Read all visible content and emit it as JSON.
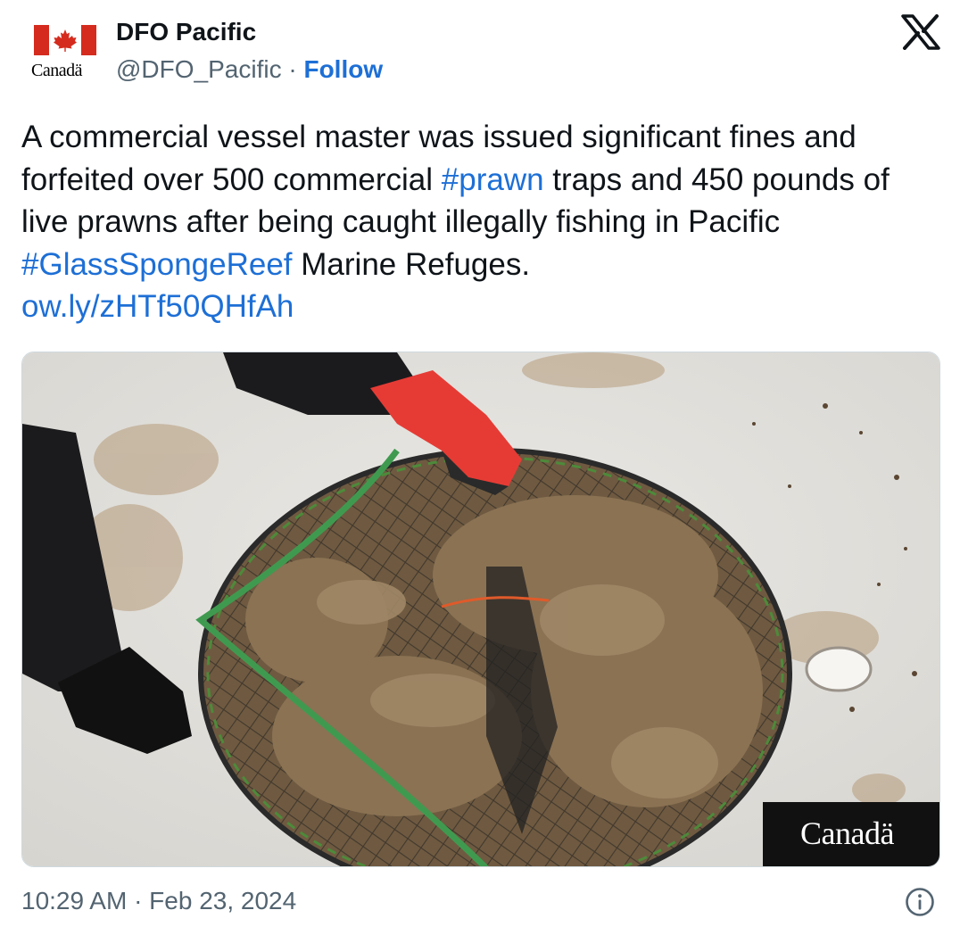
{
  "account": {
    "name": "DFO Pacific",
    "handle": "@DFO_Pacific",
    "separator": " · ",
    "follow_label": "Follow",
    "avatar_wordmark": "Canadä",
    "avatar_icon": "canada-flag-icon"
  },
  "brand": {
    "logo_icon": "x-logo-icon"
  },
  "tweet": {
    "text_1": "A commercial vessel master was issued significant fines and forfeited over 500 commercial ",
    "hashtag_1": "#prawn",
    "text_2": " traps and 450 pounds of live prawns after being caught illegally fishing in Pacific ",
    "hashtag_2": "#GlassSpongeReef",
    "text_3": " Marine Refuges.",
    "link": "ow.ly/zHTf50QHfAh"
  },
  "media": {
    "watermark": "Canadä"
  },
  "footer": {
    "timestamp": "10:29 AM · Feb 23, 2024",
    "info_icon": "info-icon"
  },
  "colors": {
    "link": "#1d6fd6",
    "text": "#0f1419",
    "muted": "#536471",
    "canada_red": "#d52b1e"
  }
}
